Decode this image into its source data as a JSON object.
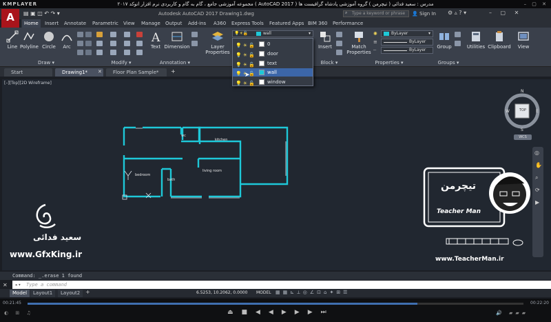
{
  "player": {
    "brand": "KMPLAYER",
    "title": "مجموعه آموزشی جامع ، گام به گام و کاربردی نرم افزار اتوکد ۲۰۱۷ ( AutoCAD 2017 ) مدرس : سعید فدائی ( تیچرمن ) گروه آموزشی پادشاه گرافیست ها",
    "time_elapsed": "00:21:45",
    "time_total": "00:22:20",
    "progress": 0.786
  },
  "app": {
    "title": "Autodesk AutoCAD 2017    Drawing1.dwg",
    "logo": "A",
    "search_placeholder": "Type a keyword or phrase",
    "signin": "Sign In"
  },
  "ribbon": {
    "tabs": [
      "Home",
      "Insert",
      "Annotate",
      "Parametric",
      "View",
      "Manage",
      "Output",
      "Add-ins",
      "A360",
      "Express Tools",
      "Featured Apps",
      "BIM 360",
      "Performance"
    ],
    "active_tab": "Home",
    "tools": {
      "line": "Line",
      "polyline": "Polyline",
      "circle": "Circle",
      "arc": "Arc",
      "text": "Text",
      "dimension": "Dimension",
      "layer_properties": "Layer Properties",
      "insert": "Insert",
      "match_properties": "Match Properties",
      "group": "Group",
      "utilities": "Utilities",
      "clipboard": "Clipboard",
      "view": "View"
    },
    "panels": {
      "draw": "Draw ▾",
      "modify": "Modify ▾",
      "annotation": "Annotation ▾",
      "block": "Block ▾",
      "properties": "Properties ▾",
      "groups": "Groups ▾"
    },
    "bylayer": "ByLayer",
    "current_layer": "wall"
  },
  "layer_dropdown": {
    "items": [
      "0",
      "door",
      "text",
      "wall",
      "window"
    ],
    "selected": "wall",
    "wall_color": "#1ec8d8"
  },
  "doc_tabs": [
    "Start",
    "Drawing1*",
    "Floor Plan Sample*"
  ],
  "active_doc": "Drawing1*",
  "viewport_label": "[–][Top][2D Wireframe]",
  "viewcube": {
    "top": "TOP",
    "n": "N",
    "s": "S",
    "w": "W",
    "e": "E",
    "wcs": "WCS"
  },
  "rooms": {
    "wc": "wc",
    "kitchen": "kitchen",
    "bedroom": "bedroom",
    "bath": "bath",
    "living": "living room"
  },
  "command": {
    "history": "Command: _.erase 1 found",
    "placeholder": "Type a command"
  },
  "layout_tabs": [
    "Model",
    "Layout1",
    "Layout2"
  ],
  "status": {
    "coords": "6.5253, 10.2062, 0.0000",
    "model": "MODEL"
  },
  "watermark": {
    "name_fa": "سعید فدائی",
    "site_left": "www.GfxKing.ir",
    "brand_fa": "تیچرمن",
    "teacher": "Teacher Man",
    "site_right": "www.TeacherMan.ir"
  }
}
